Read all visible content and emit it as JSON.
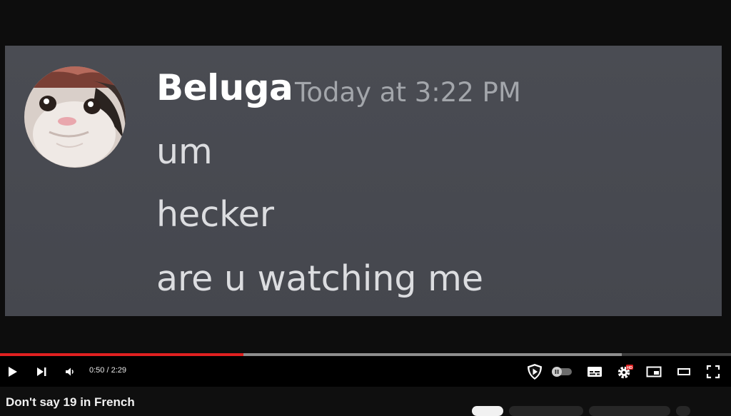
{
  "message": {
    "username": "Beluga",
    "timestamp": "Today at 3:22 PM",
    "lines": [
      "um",
      "hecker",
      "are u watching me"
    ],
    "avatar_icon": "cat-face-avatar"
  },
  "player": {
    "current_time": "0:50",
    "duration": "2:29",
    "time_display": "0:50 / 2:29",
    "played_fraction": 0.333,
    "buffered_fraction": 0.851,
    "autoplay": "off",
    "quality_badge": "HD",
    "progress_color": "#e02020",
    "icons": [
      "play-icon",
      "next-icon",
      "volume-icon",
      "shield-play-icon",
      "autoplay-toggle",
      "subtitles-icon",
      "settings-icon",
      "miniplayer-icon",
      "theater-icon",
      "fullscreen-icon"
    ]
  },
  "video": {
    "title": "Don't say 19 in French"
  }
}
